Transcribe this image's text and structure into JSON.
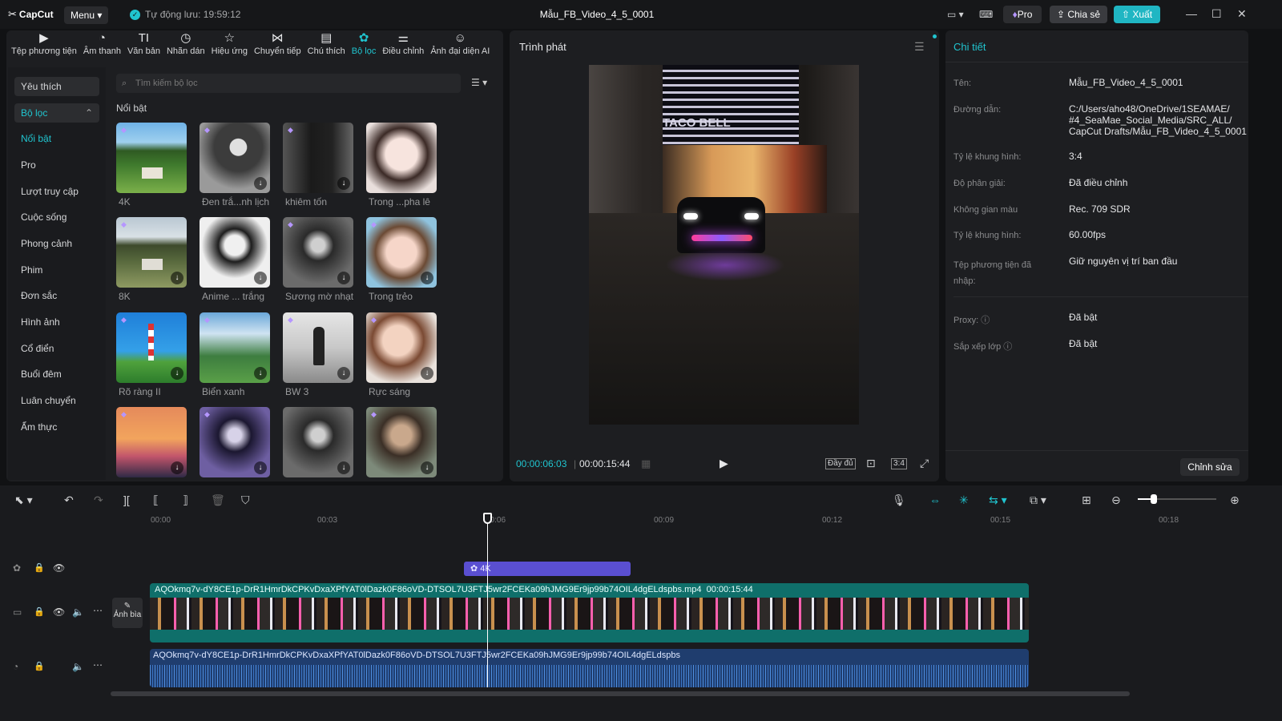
{
  "app": {
    "logo": "CapCut",
    "menu": "Menu",
    "autosave": "Tự động lưu: 19:59:12",
    "project_title": "Mẫu_FB_Video_4_5_0001",
    "pro": "Pro",
    "share": "Chia sẻ",
    "export": "Xuất"
  },
  "toolbar": [
    "Tệp phương tiện",
    "Âm thanh",
    "Văn bản",
    "Nhãn dán",
    "Hiệu ứng",
    "Chuyển tiếp",
    "Chú thích",
    "Bộ lọc",
    "Điều chỉnh",
    "Ảnh đại diện AI"
  ],
  "nav": {
    "favorites": "Yêu thích",
    "filters": "Bộ lọc",
    "items": [
      "Nổi bật",
      "Pro",
      "Lượt truy cập",
      "Cuộc sống",
      "Phong cảnh",
      "Phim",
      "Đơn sắc",
      "Hình ảnh",
      "Cổ điển",
      "Buổi đêm",
      "Luân chuyển",
      "Ẩm thực"
    ]
  },
  "search": {
    "placeholder": "Tìm kiếm bộ lọc"
  },
  "section_title": "Nổi bật",
  "filters": [
    "4K",
    "Đen trắ...nh lịch",
    "khiêm tốn",
    "Trong ...pha lê",
    "8K",
    "Anime ... trắng",
    "Sương mờ nhạt",
    "Trong trẻo",
    "Rõ ràng II",
    "Biển xanh",
    "BW 3",
    "Rực sáng"
  ],
  "player": {
    "title": "Trình phát",
    "current": "00:00:06:03",
    "duration": "00:00:15:44",
    "full": "Đầy đủ",
    "ratio": "3:4",
    "sign": "TACO BELL"
  },
  "details": {
    "title": "Chi tiết",
    "rows": [
      {
        "label": "Tên:",
        "value": "Mẫu_FB_Video_4_5_0001"
      },
      {
        "label": "Đường dẫn:",
        "value": "C:/Users/aho48/OneDrive/1SEAMAE/\n#4_SeaMae_Social_Media/SRC_ALL/\nCapCut Drafts/Mẫu_FB_Video_4_5_0001"
      },
      {
        "label": "Tỷ lệ khung hình:",
        "value": "3:4"
      },
      {
        "label": "Độ phân giải:",
        "value": "Đã điều chỉnh"
      },
      {
        "label": "Không gian màu",
        "value": "Rec. 709 SDR"
      },
      {
        "label": "Tỷ lệ khung hình:",
        "value": "60.00fps"
      },
      {
        "label": "Tệp phương tiện đã\nnhập:",
        "value": "Giữ nguyên vị trí ban đầu"
      },
      {
        "label": "Proxy:",
        "value": "Đã bật"
      },
      {
        "label": "Sắp xếp lớp",
        "value": "Đã bật"
      }
    ],
    "edit": "Chỉnh sửa"
  },
  "timeline": {
    "ruler": [
      "00:00",
      "00:03",
      "00:06",
      "00:09",
      "00:12",
      "00:15",
      "00:18"
    ],
    "filter_clip": "4K",
    "video_clip": "AQOkmq7v-dY8CE1p-DrR1HmrDkCPKvDxaXPfYAT0lDazk0F86oVD-DTSOL7U3FTJ5wr2FCEKa09hJMG9Er9jp99b74OIL4dgELdspbs.mp4",
    "video_duration": "00:00:15:44",
    "cover": "Ảnh bìa",
    "audio_clip": "AQOkmq7v-dY8CE1p-DrR1HmrDkCPKvDxaXPfYAT0lDazk0F86oVD-DTSOL7U3FTJ5wr2FCEKa09hJMG9Er9jp99b74OIL4dgELdspbs"
  },
  "colors": {
    "accent": "#20c4cf",
    "filter_clip": "#5a4fd1",
    "video_track": "#0f6f6a",
    "audio_track": "#1f3d6e"
  }
}
